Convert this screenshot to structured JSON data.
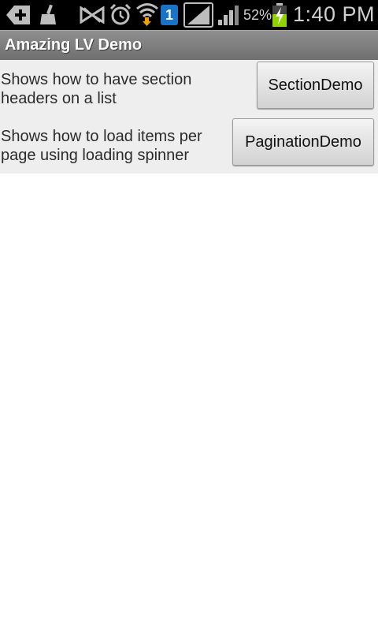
{
  "status_bar": {
    "battery_percent": "52%",
    "notification_badge": "1",
    "time": "1:40 PM",
    "icons": [
      "add-icon",
      "broom-icon",
      "signal-blocked-icon",
      "alarm-icon",
      "wifi-download-icon",
      "notification-badge-icon",
      "signal-strength-icon",
      "signal-strength-icon",
      "battery-charging-icon"
    ]
  },
  "title_bar": {
    "title": "Amazing LV Demo"
  },
  "list": {
    "items": [
      {
        "description": "Shows how to have section headers on a list",
        "button_label": "SectionDemo"
      },
      {
        "description": "Shows how to load items per page using loading spinner",
        "button_label": "PaginationDemo"
      }
    ]
  },
  "colors": {
    "status_bar_bg": "#000000",
    "title_bar_bg": "#7f7f7f",
    "content_bg": "#eeeeee",
    "page_bg": "#ffffff",
    "battery_bolt": "#8fd400",
    "badge_blue": "#1a73c7"
  }
}
